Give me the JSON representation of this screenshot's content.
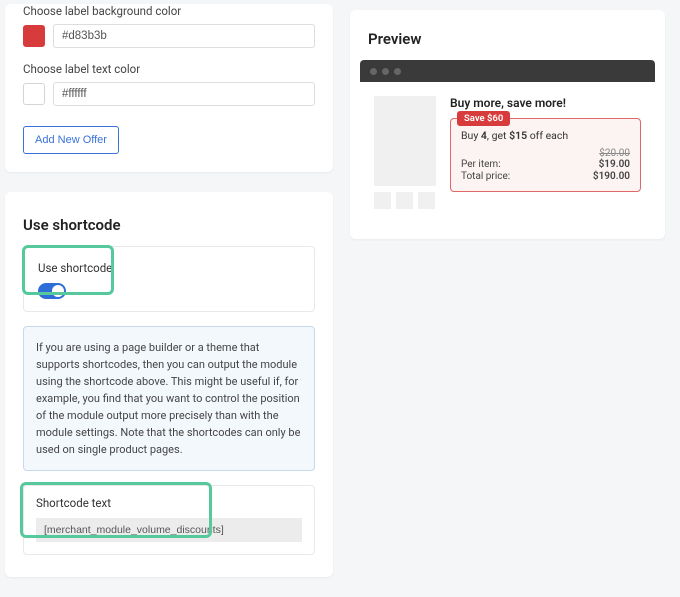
{
  "colorSettings": {
    "bgLabel": "Choose label background color",
    "bgValue": "#d83b3b",
    "textLabel": "Choose label text color",
    "textValue": "#ffffff",
    "addOffer": "Add New Offer"
  },
  "shortcode": {
    "sectionTitle": "Use shortcode",
    "toggleLabel": "Use shortcode",
    "infoText": "If you are using a page builder or a theme that supports shortcodes, then you can output the module using the shortcode above. This might be useful if, for example, you find that you want to control the position of the module output more precisely than with the module settings. Note that the shortcodes can only be used on single product pages.",
    "fieldLabel": "Shortcode text",
    "fieldValue": "[merchant_module_volume_discounts]"
  },
  "preview": {
    "title": "Preview",
    "heading": "Buy more, save more!",
    "badge": "Save $60",
    "mainLine_pre": "Buy ",
    "mainLine_qty": "4",
    "mainLine_mid": ", get ",
    "mainLine_disc": "$15",
    "mainLine_post": " off each",
    "strikePrice": "$20.00",
    "perItemLabel": "Per item:",
    "perItemValue": "$19.00",
    "totalLabel": "Total price:",
    "totalValue": "$190.00"
  }
}
